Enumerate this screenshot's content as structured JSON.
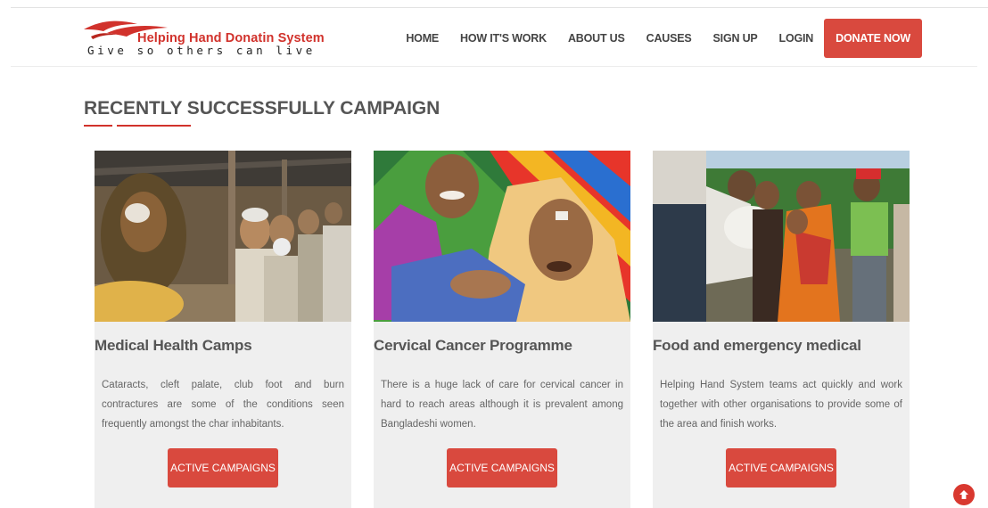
{
  "brand": {
    "title": "Helping Hand Donatin System",
    "tagline": "Give so others can live",
    "logo_icon": "swoosh-logo-icon",
    "accent_color": "#d9493e"
  },
  "nav": {
    "items": [
      "HOME",
      "HOW IT'S WORK",
      "ABOUT US",
      "CAUSES",
      "SIGN UP",
      "LOGIN"
    ],
    "donate_label": "DONATE NOW"
  },
  "section": {
    "title": "RECENTLY SUCCESSFULLY CAMPAIGN"
  },
  "cards": [
    {
      "image": "people-at-medical-camp-photo",
      "title": "Medical Health Camps",
      "text": "Cataracts, cleft palate, club foot and burn contractures are some of the conditions seen frequently amongst the char inhabitants.",
      "button": "ACTIVE CAMPAIGNS"
    },
    {
      "image": "smiling-elderly-women-photo",
      "title": "Cervical Cancer Programme",
      "text": "There is a huge lack of care for cervical cancer in hard to reach areas although it is prevalent among Bangladeshi women.",
      "button": "ACTIVE CAMPAIGNS"
    },
    {
      "image": "food-aid-distribution-photo",
      "title": "Food and emergency medical",
      "text": "Helping Hand System teams act quickly and work together with other organisations to provide some of the area and finish works.",
      "button": "ACTIVE CAMPAIGNS"
    }
  ],
  "scroll_top_icon": "arrow-up-circle-icon"
}
